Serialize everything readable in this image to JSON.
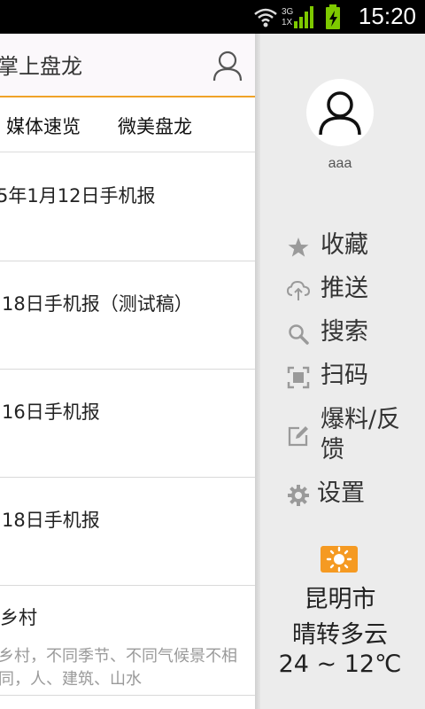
{
  "status_bar": {
    "time": "15:20",
    "network_label": "3G",
    "network_sub": "1X"
  },
  "header": {
    "title": "掌上盘龙"
  },
  "tabs": [
    {
      "label": "媒体速览"
    },
    {
      "label": "微美盘龙"
    }
  ],
  "list": [
    {
      "title": "5年1月12日手机报",
      "subtitle": ""
    },
    {
      "title": "18日手机报（测试稿）",
      "subtitle": ""
    },
    {
      "title": "16日手机报",
      "subtitle": ""
    },
    {
      "title": "18日手机报",
      "subtitle": ""
    },
    {
      "title": "乡村",
      "subtitle": "乡村，不同季节、不同气候景不相同，人、建筑、山水"
    }
  ],
  "drawer": {
    "username": "aaa",
    "menu": [
      {
        "label": "收藏",
        "icon": "star-icon"
      },
      {
        "label": "推送",
        "icon": "cloud-upload-icon"
      },
      {
        "label": "搜索",
        "icon": "search-icon"
      },
      {
        "label": "扫码",
        "icon": "scan-icon"
      },
      {
        "label": "爆料/反馈",
        "icon": "edit-icon"
      },
      {
        "label": "设置",
        "icon": "gear-icon"
      }
    ]
  },
  "weather": {
    "city": "昆明市",
    "condition": "晴转多云",
    "temperature": "24 ~ 12℃",
    "icon": "sun-icon",
    "icon_color": "#f59a22"
  },
  "colors": {
    "accent": "#f0a328",
    "drawer_bg": "#ececec"
  }
}
